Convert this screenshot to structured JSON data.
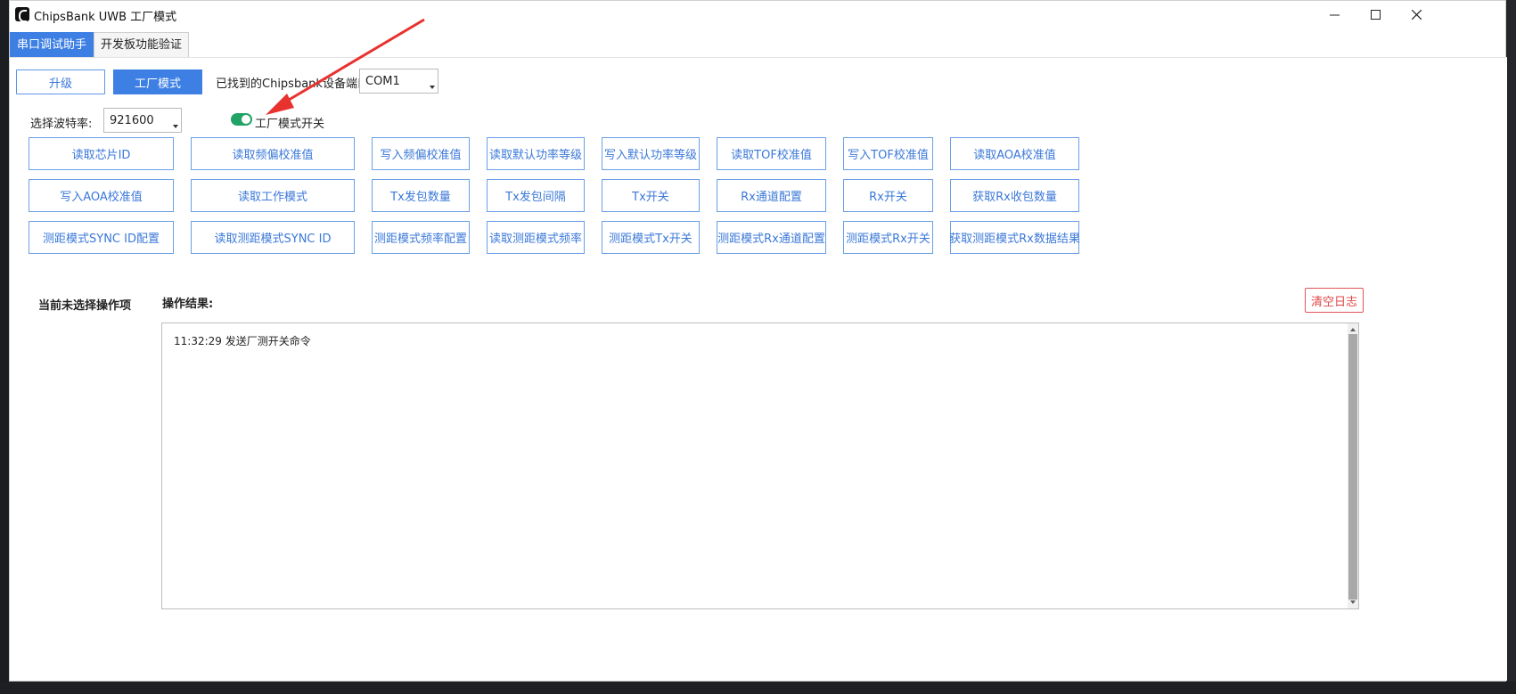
{
  "window": {
    "title": "ChipsBank UWB 工厂模式",
    "controls": [
      "minimize-icon",
      "maximize-icon",
      "close-icon"
    ]
  },
  "tabs": [
    {
      "label": "串口调试助手",
      "active": true
    },
    {
      "label": "开发板功能验证",
      "active": false
    }
  ],
  "toolbar": {
    "upgrade_label": "升级",
    "factory_mode_label": "工厂模式",
    "port_label": "已找到的Chipsbank设备端口",
    "port_value": "COM1"
  },
  "settings": {
    "baud_label": "选择波特率:",
    "baud_value": "921600",
    "factory_switch_label": "工厂模式开关",
    "factory_switch_on": true
  },
  "function_buttons": {
    "row1": [
      "读取芯片ID",
      "读取频偏校准值",
      "写入频偏校准值",
      "读取默认功率等级",
      "写入默认功率等级",
      "读取TOF校准值",
      "写入TOF校准值",
      "读取AOA校准值"
    ],
    "row2": [
      "写入AOA校准值",
      "读取工作模式",
      "Tx发包数量",
      "Tx发包间隔",
      "Tx开关",
      "Rx通道配置",
      "Rx开关",
      "获取Rx收包数量"
    ],
    "row3": [
      "测距模式SYNC ID配置",
      "读取测距模式SYNC ID",
      "测距模式频率配置",
      "读取测距模式频率",
      "测距模式Tx开关",
      "测距模式Rx通道配置",
      "测距模式Rx开关",
      "获取测距模式Rx数据结果"
    ]
  },
  "status": {
    "current_op": "当前未选择操作项",
    "result_label": "操作结果:",
    "clear_log_label": "清空日志"
  },
  "log": {
    "lines": [
      "11:32:29 发送厂测开关命令"
    ]
  },
  "colors": {
    "accent": "#3d7fe3",
    "toggle_on": "#21a366",
    "danger": "#e04545",
    "annotation_arrow": "#e8322f"
  }
}
